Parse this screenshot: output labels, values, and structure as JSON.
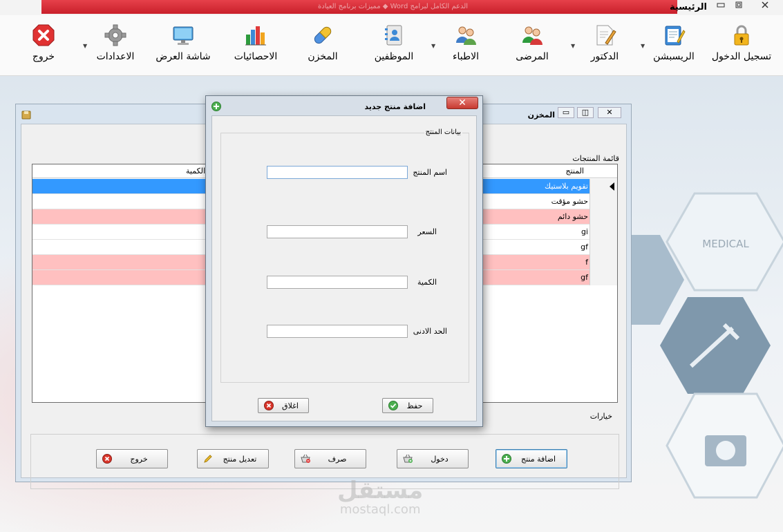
{
  "window": {
    "title": "الرئيسية",
    "banner_text": "مميزات برنامج العيادة  ◆  Word الدعم الكامل لبرامج"
  },
  "toolbar": {
    "items": [
      {
        "label": "تسجيل الدخول",
        "icon": "lock-icon"
      },
      {
        "label": "الريسبشن",
        "icon": "notepad-pen-icon",
        "dropdown": true
      },
      {
        "label": "الدكتور",
        "icon": "document-pen-icon",
        "dropdown": true
      },
      {
        "label": "المرضى",
        "icon": "patients-icon"
      },
      {
        "label": "الاطباء",
        "icon": "doctors-icon",
        "dropdown": true
      },
      {
        "label": "الموظفين",
        "icon": "contacts-book-icon"
      },
      {
        "label": "المخزن",
        "icon": "pill-icon"
      },
      {
        "label": "الاحصائيات",
        "icon": "bar-chart-icon"
      },
      {
        "label": "شاشة العرض",
        "icon": "monitor-icon"
      },
      {
        "label": "الاعدادات",
        "icon": "gear-icon",
        "dropdown": true
      },
      {
        "label": "خروج",
        "icon": "exit-icon"
      }
    ]
  },
  "background": {
    "medical_text": "MEDICAL"
  },
  "store_window": {
    "title": "المخزن",
    "products_group": "قائمة المنتجات",
    "columns": {
      "product": "المنتج",
      "quantity": "الكمية"
    },
    "rows": [
      {
        "name": "تقويم بلاستيك",
        "style": "selected"
      },
      {
        "name": "حشو مؤقت",
        "style": "normal"
      },
      {
        "name": "حشو دائم",
        "style": "low"
      },
      {
        "name": "gi",
        "style": "normal"
      },
      {
        "name": "gf",
        "style": "normal"
      },
      {
        "name": "f",
        "style": "low"
      },
      {
        "name": "gf",
        "style": "low"
      }
    ],
    "options_group": "خيارات",
    "buttons": {
      "add": "اضافة منتج",
      "entry": "دخول",
      "dispense": "صرف",
      "edit": "تعديل منتج",
      "exit": "خروج"
    }
  },
  "dialog": {
    "title": "اضافة منتج جديد",
    "group": "بيانات المنتج",
    "fields": {
      "name": {
        "label": "اسم المنتج",
        "value": ""
      },
      "price": {
        "label": "السعر",
        "value": ""
      },
      "quantity": {
        "label": "الكمية",
        "value": ""
      },
      "min": {
        "label": "الحد الادنى",
        "value": ""
      }
    },
    "save": "حفظ",
    "close": "اغلاق"
  },
  "watermark": {
    "arabic": "مستقل",
    "latin": "mostaql.com"
  },
  "colors": {
    "selected_row": "#3399ff",
    "low_stock_row": "#ffc0c0",
    "title_red": "#d4262f",
    "save_green": "#4caf50",
    "close_red": "#d9362b"
  }
}
